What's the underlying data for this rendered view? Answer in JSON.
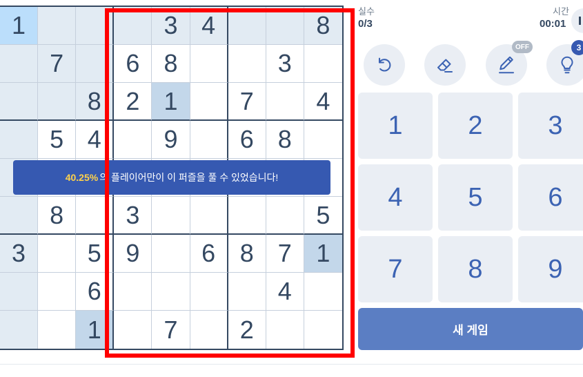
{
  "stats": {
    "mistakes_label": "실수",
    "mistakes_value": "0/3",
    "time_label": "시간",
    "time_value": "00:01"
  },
  "tools": {
    "pencil_badge": "OFF",
    "hint_badge": "3"
  },
  "toast": {
    "percent": "40.25%",
    "text": "의 플레이어만이 이 퍼즐을 풀 수 있었습니다!"
  },
  "numpad": [
    "1",
    "2",
    "3",
    "4",
    "5",
    "6",
    "7",
    "8",
    "9"
  ],
  "new_game_label": "새 게임",
  "board": [
    [
      "1",
      "",
      "",
      "",
      "3",
      "4",
      "",
      "",
      "8"
    ],
    [
      "",
      "7",
      "",
      "6",
      "8",
      "",
      "",
      "3",
      ""
    ],
    [
      "",
      "",
      "8",
      "2",
      "1",
      "",
      "7",
      "",
      "4"
    ],
    [
      "",
      "5",
      "4",
      "",
      "9",
      "",
      "6",
      "8",
      ""
    ],
    [
      "",
      "",
      "",
      "",
      "",
      "",
      "",
      "",
      ""
    ],
    [
      "",
      "8",
      "",
      "3",
      "",
      "",
      "",
      "",
      "5"
    ],
    [
      "3",
      "",
      "5",
      "9",
      "",
      "6",
      "8",
      "7",
      "1"
    ],
    [
      "",
      "",
      "6",
      "",
      "",
      "",
      "",
      "4",
      ""
    ],
    [
      "",
      "",
      "1",
      "",
      "7",
      "",
      "2",
      "",
      ""
    ]
  ],
  "colors": {
    "grid_line": "#344861",
    "highlight": "#e2ebf3",
    "same_number": "#c3d7ea",
    "selected": "#bbdefb",
    "accent": "#3c63b3",
    "toast_bg": "#3659b1",
    "annotation": "#ff0000"
  }
}
